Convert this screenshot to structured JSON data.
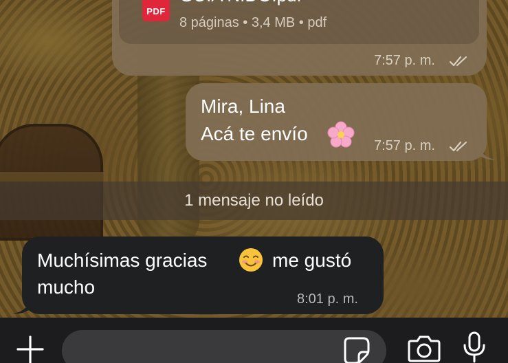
{
  "chat": {
    "document": {
      "file_name": "GUÍA NIDO.pdf",
      "icon_label": "PDF",
      "meta": "8 páginas • 3,4 MB • pdf",
      "time": "7:57 p. m.",
      "status": "read-double-check-icon"
    },
    "outgoing_message": {
      "line1": "Mira, Lina",
      "line2": "Acá te envío",
      "emoji": "cherry-blossom",
      "time": "7:57 p. m.",
      "status": "read-double-check-icon"
    },
    "unread_divider": "1 mensaje no leído",
    "incoming_message": {
      "line1_before_emoji": "Muchísimas gracias",
      "emoji": "smiling-face",
      "line1_after_emoji": "me gustó",
      "line2": "mucho",
      "time": "8:01 p. m."
    }
  },
  "input_bar": {
    "compose_placeholder": "",
    "icons": [
      "plus-icon",
      "sticker-icon",
      "camera-icon",
      "microphone-icon"
    ]
  },
  "colors": {
    "outgoing_bubble": "#806c52",
    "incoming_bubble": "#1f2021",
    "pdf_icon": "#e0263b",
    "bottom_bar": "#1c1c1e"
  }
}
